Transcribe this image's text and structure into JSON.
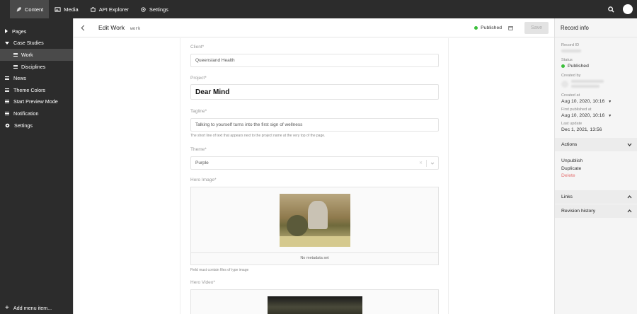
{
  "topnav": {
    "content": "Content",
    "media": "Media",
    "api_explorer": "API Explorer",
    "settings": "Settings"
  },
  "sidebar": {
    "items": [
      {
        "label": "Pages"
      },
      {
        "label": "Case Studies"
      },
      {
        "label": "Work"
      },
      {
        "label": "Disciplines"
      },
      {
        "label": "News"
      },
      {
        "label": "Theme Colors"
      },
      {
        "label": "Start Preview Mode"
      },
      {
        "label": "Notification"
      },
      {
        "label": "Settings"
      }
    ],
    "footer": "Add menu item..."
  },
  "header": {
    "title": "Edit Work",
    "model": "work",
    "status": "Published",
    "save_label": "Save"
  },
  "form": {
    "client": {
      "label": "Client*",
      "value": "Queensland Health"
    },
    "project": {
      "label": "Project*",
      "value": "Dear Mind"
    },
    "tagline": {
      "label": "Tagline*",
      "value": "Talking to yourself turns into the first sign of wellness",
      "hint": "The short line of text that appears next to the project name at the very top of the page."
    },
    "theme": {
      "label": "Theme*",
      "value": "Purple"
    },
    "hero_image": {
      "label": "Hero Image*",
      "meta": "No metadata set",
      "hint": "Field must contain files of type image"
    },
    "hero_video": {
      "label": "Hero Video*"
    }
  },
  "record": {
    "title": "Record info",
    "record_id_label": "Record ID",
    "status_label": "Status",
    "status": "Published",
    "created_by_label": "Created by",
    "created_at_label": "Created at",
    "created_at": "Aug 10, 2020, 10:16",
    "first_published_label": "First published at",
    "first_published": "Aug 10, 2020, 10:16",
    "last_update_label": "Last update",
    "last_update": "Dec 1, 2021, 13:56",
    "actions_label": "Actions",
    "actions": [
      "Unpublish",
      "Duplicate",
      "Delete"
    ],
    "links_label": "Links",
    "revision_label": "Revision history"
  },
  "colors": {
    "published": "#3bbf3b",
    "delete": "#e57373",
    "sidebar_bg": "#2c2c2c"
  }
}
